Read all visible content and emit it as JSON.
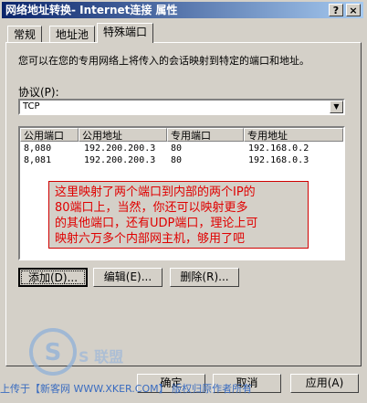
{
  "window": {
    "title": "网络地址转换- Internet连接 属性",
    "help_button": "?",
    "close_button": "×"
  },
  "tabs": [
    {
      "label": "常规"
    },
    {
      "label": "地址池"
    },
    {
      "label": "特殊端口"
    }
  ],
  "description": "您可以在您的专用网络上将传入的会话映射到特定的端口和地址。",
  "protocol": {
    "label": "协议(P):",
    "value": "TCP"
  },
  "table": {
    "headers": [
      "公用端口",
      "公用地址",
      "专用端口",
      "专用地址"
    ],
    "rows": [
      [
        "8,080",
        "192.200.200.3",
        "80",
        "192.168.0.2"
      ],
      [
        "8,081",
        "192.200.200.3",
        "80",
        "192.168.0.3"
      ]
    ]
  },
  "annotation": {
    "line1": "这里映射了两个端口到内部的两个IP的",
    "line2": "80端口上，当然，你还可以映射更多",
    "line3": "的其他端口，还有UDP端口，理论上可",
    "line4": "映射六万多个内部网主机，够用了吧",
    "color": "#e00000"
  },
  "actions": {
    "add": "添加(D)...",
    "edit": "编辑(E)...",
    "delete": "删除(R)..."
  },
  "footer": {
    "ok": "确定",
    "cancel": "取消",
    "apply": "应用(A)"
  },
  "watermark": {
    "text": "上传于【新客网 WWW.XKER.COM】 版权归原作者所有",
    "logo_text": "S 联盟"
  },
  "colors": {
    "title_gradient_start": "#0a246a",
    "title_gradient_end": "#a6caf0",
    "dialog_bg": "#d4d0c8"
  }
}
